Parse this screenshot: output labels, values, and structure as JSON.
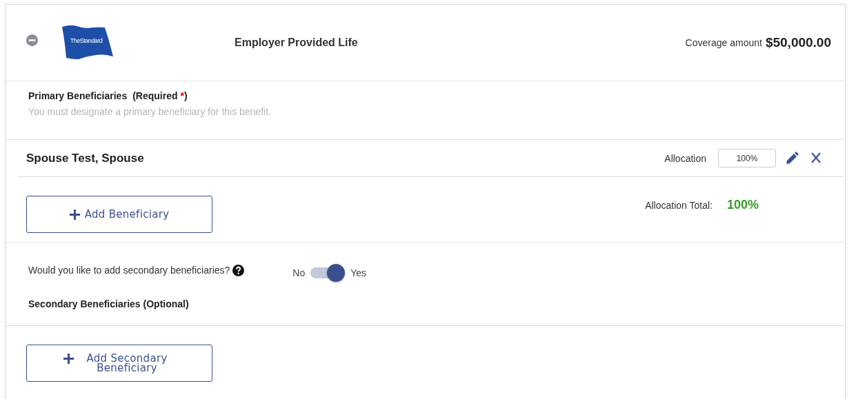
{
  "header": {
    "expanded": true,
    "logo_text": "TheStandard",
    "title": "Employer Provided Life",
    "coverage_label": "Coverage amount",
    "coverage_amount": "$50,000.00"
  },
  "primary": {
    "title": "Primary Beneficiaries",
    "required_label": "(Required",
    "required_mark": "*",
    "required_close": ")",
    "hint": "You must designate a primary beneficiary for this benefit."
  },
  "beneficiaries": [
    {
      "name": "Spouse Test, Spouse",
      "allocation_label": "Allocation",
      "allocation": "100%"
    }
  ],
  "add_button": "Add Beneficiary",
  "allocation_total_label": "Allocation Total:",
  "allocation_total": "100%",
  "secondary": {
    "question": "Would you like to add secondary beneficiaries?",
    "toggle": {
      "off_label": "No",
      "on_label": "Yes",
      "on": true
    },
    "title": "Secondary Beneficiaries (Optional)",
    "add_button": "Add Secondary Beneficiary"
  }
}
